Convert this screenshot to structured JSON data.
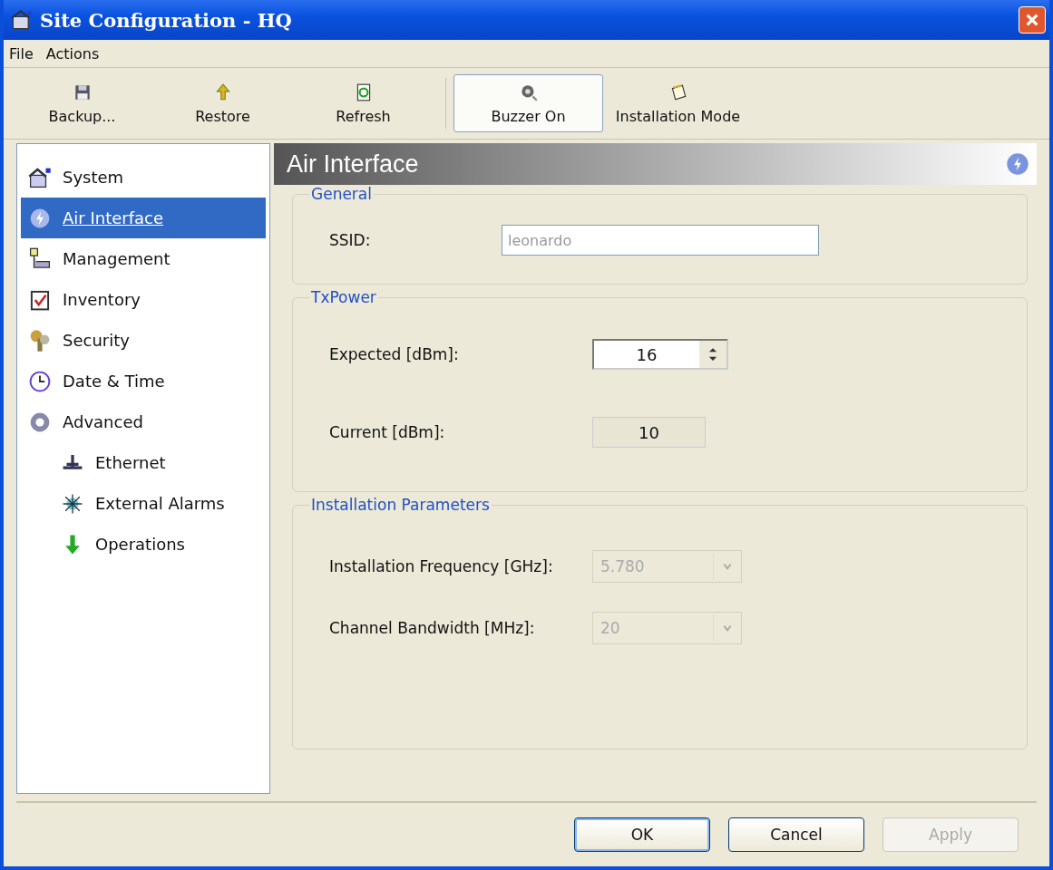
{
  "window": {
    "title": "Site Configuration - HQ"
  },
  "menu": [
    "File",
    "Actions"
  ],
  "toolbar": [
    {
      "label": "Backup...",
      "selected": false
    },
    {
      "label": "Restore",
      "selected": false
    },
    {
      "label": "Refresh",
      "selected": false
    },
    {
      "label": "Buzzer On",
      "selected": true
    },
    {
      "label": "Installation Mode",
      "selected": false
    }
  ],
  "sidebar": {
    "items": [
      {
        "label": "System",
        "selected": false
      },
      {
        "label": "Air Interface",
        "selected": true
      },
      {
        "label": "Management",
        "selected": false
      },
      {
        "label": "Inventory",
        "selected": false
      },
      {
        "label": "Security",
        "selected": false
      },
      {
        "label": "Date & Time",
        "selected": false
      },
      {
        "label": "Advanced",
        "selected": false,
        "children": [
          {
            "label": "Ethernet",
            "selected": false
          },
          {
            "label": "External Alarms",
            "selected": false
          },
          {
            "label": "Operations",
            "selected": false
          }
        ]
      }
    ]
  },
  "panel": {
    "title": "Air Interface",
    "groups": [
      {
        "title": "General",
        "fields": [
          {
            "label": "SSID:",
            "kind": "text",
            "value": "leonardo",
            "disabled": true
          }
        ]
      },
      {
        "title": "TxPower",
        "fields": [
          {
            "label": "Expected [dBm]:",
            "kind": "spinner",
            "value": "16",
            "disabled": false
          },
          {
            "label": "Current [dBm]:",
            "kind": "readout",
            "value": "10"
          }
        ]
      },
      {
        "title": "Installation Parameters",
        "fields": [
          {
            "label": "Installation Frequency [GHz]:",
            "kind": "dropdown",
            "value": "5.780",
            "disabled": true
          },
          {
            "label": "Channel Bandwidth [MHz]:",
            "kind": "dropdown",
            "value": "20",
            "disabled": true
          }
        ]
      }
    ]
  },
  "buttons": [
    {
      "label": "OK",
      "disabled": false,
      "default": true
    },
    {
      "label": "Cancel",
      "disabled": false,
      "default": false
    },
    {
      "label": "Apply",
      "disabled": true,
      "default": false
    }
  ]
}
